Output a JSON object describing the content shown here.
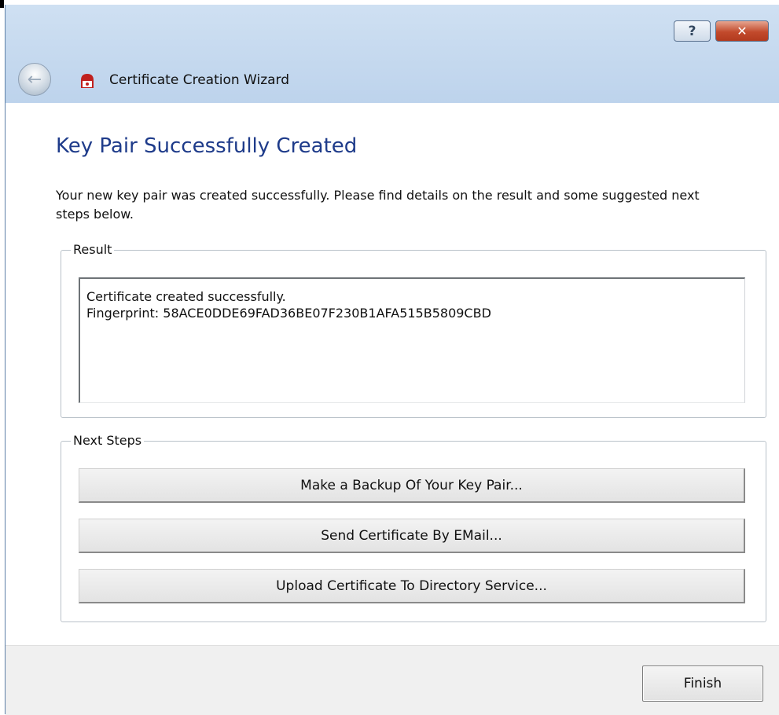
{
  "window": {
    "title": "Certificate Creation Wizard",
    "help_label": "?",
    "close_label": "✕",
    "back_icon": "back-arrow-icon",
    "app_icon": "certificate-app-icon"
  },
  "page": {
    "title": "Key Pair Successfully Created",
    "intro": "Your new key pair was created successfully. Please find details on the result and some suggested next steps below."
  },
  "result": {
    "group_label": "Result",
    "text": "Certificate created successfully.\nFingerprint: 58ACE0DDE69FAD36BE07F230B1AFA515B5809CBD"
  },
  "next_steps": {
    "group_label": "Next Steps",
    "backup_label": "Make a Backup Of Your Key Pair...",
    "email_label": "Send Certificate By EMail...",
    "upload_label": "Upload Certificate To Directory Service..."
  },
  "footer": {
    "finish_label": "Finish"
  },
  "colors": {
    "accent_title": "#1e3b8a",
    "titlebar": "#c9dcf0",
    "close_button": "#c24a2c"
  }
}
